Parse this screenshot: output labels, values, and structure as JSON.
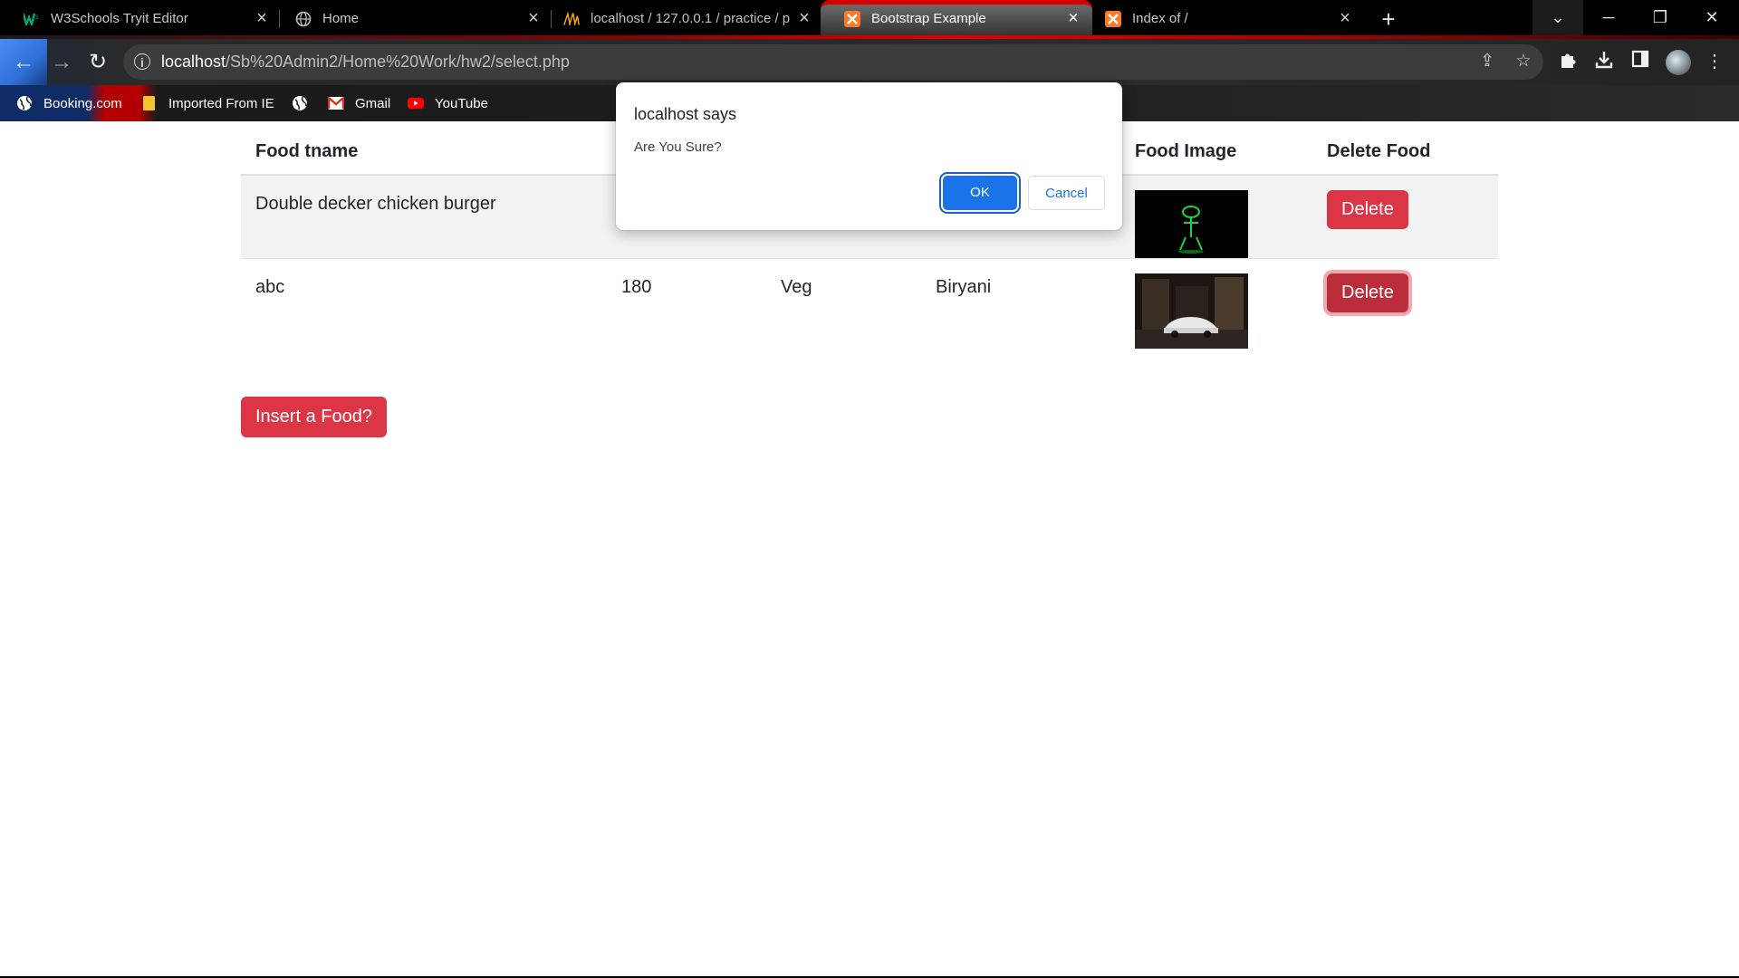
{
  "browser": {
    "tabs": [
      {
        "title": "W3Schools Tryit Editor",
        "favicon": "w3schools-icon",
        "active": false
      },
      {
        "title": "Home",
        "favicon": "globe-icon",
        "active": false
      },
      {
        "title": "localhost / 127.0.0.1 / practice / p",
        "favicon": "phpmyadmin-icon",
        "active": false
      },
      {
        "title": "Bootstrap Example",
        "favicon": "xampp-icon",
        "active": true
      },
      {
        "title": "Index of /",
        "favicon": "xampp-icon",
        "active": false
      }
    ],
    "address": {
      "host": "localhost",
      "path": "/Sb%20Admin2/Home%20Work/hw2/select.php"
    },
    "bookmarks": [
      {
        "label": "Booking.com",
        "icon": "globe-icon"
      },
      {
        "label": "Imported From IE",
        "icon": "folder-icon"
      },
      {
        "label": "",
        "icon": "globe-icon"
      },
      {
        "label": "Gmail",
        "icon": "gmail-icon"
      },
      {
        "label": "YouTube",
        "icon": "youtube-icon"
      }
    ]
  },
  "table": {
    "headers": [
      "Food tname",
      "",
      "",
      "",
      "Food Image",
      "Delete Food"
    ],
    "rows": [
      {
        "name": "Double decker chicken burger",
        "price": "",
        "type": "",
        "category": "",
        "delete_label": "Delete"
      },
      {
        "name": "abc",
        "price": "180",
        "type": "Veg",
        "category": "Biryani",
        "delete_label": "Delete"
      }
    ]
  },
  "insert_button": "Insert a Food?",
  "dialog": {
    "title": "localhost says",
    "message": "Are You Sure?",
    "ok_label": "OK",
    "cancel_label": "Cancel"
  },
  "colors": {
    "danger": "#dc3545",
    "accent": "#1a73e8",
    "theme_red": "#d80000"
  }
}
